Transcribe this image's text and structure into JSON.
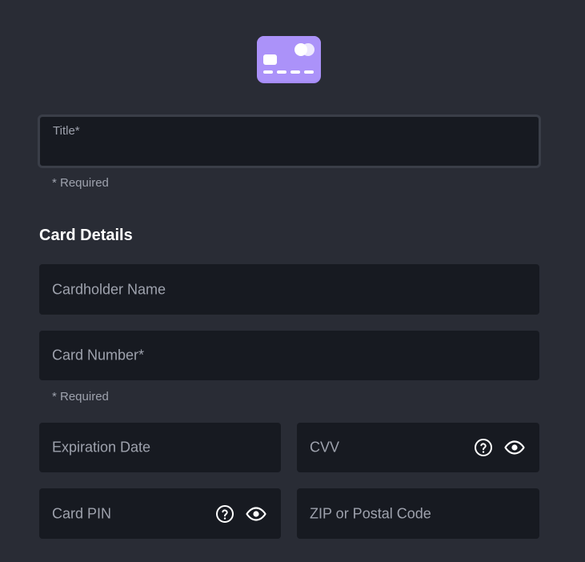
{
  "title_field": {
    "label": "Title*",
    "value": "",
    "helper": "* Required"
  },
  "section": {
    "heading": "Card Details"
  },
  "fields": {
    "cardholder_name": "Cardholder Name",
    "card_number": "Card Number*",
    "card_number_helper": "* Required",
    "expiration_date": "Expiration Date",
    "cvv": "CVV",
    "card_pin": "Card PIN",
    "zip": "ZIP or Postal Code"
  },
  "icons": {
    "card": "credit-card-icon",
    "help": "help-circle-icon",
    "reveal": "eye-icon"
  },
  "colors": {
    "accent": "#a58bf7",
    "background": "#292c35",
    "field": "#171a21"
  }
}
